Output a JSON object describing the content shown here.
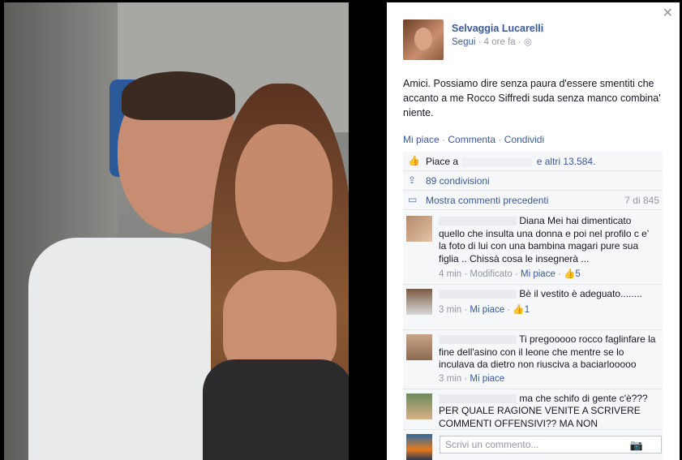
{
  "post": {
    "author": "Selvaggia Lucarelli",
    "follow": "Segui",
    "time": "4 ore fa",
    "privacy_icon": "globe-icon",
    "text": "Amici. Possiamo dire senza paura d'essere smentiti che accanto a me Rocco Siffredi suda senza manco combina' niente."
  },
  "actions": {
    "like": "Mi piace",
    "comment": "Commenta",
    "share": "Condividi"
  },
  "ufi": {
    "likes_prefix": "Piace a",
    "likes_suffix": "e altri 13.584.",
    "shares": "89 condivisioni",
    "more_comments": "Mostra commenti precedenti",
    "count": "7 di 845"
  },
  "comments": [
    {
      "text": "Diana Mei hai dimenticato quello che insulta una donna e poi nel profilo c e' la foto di lui con una bambina magari pure sua figlia .. Chissà cosa le insegnerà ...",
      "time": "4 min",
      "edited": "Modificato",
      "like": "Mi piace",
      "likes": "5"
    },
    {
      "text": "Bè il vestito è adeguato........",
      "time": "3 min",
      "like": "Mi piace",
      "likes": "1"
    },
    {
      "text": "Ti pregooooo rocco faglinfare la fine dell'asino con il leone che mentre se lo inculava da dietro non riusciva a baciarlooooo",
      "time": "3 min",
      "like": "Mi piace"
    },
    {
      "text": "ma che schifo di gente c'è??? PER QUALE RAGIONE VENITE A SCRIVERE COMMENTI OFFENSIVI?? MA NON",
      "time": "",
      "like": ""
    }
  ],
  "composer": {
    "placeholder": "Scrivi un commento..."
  },
  "icons": {
    "close": "close-icon",
    "camera": "camera-icon",
    "like": "thumbs-up-icon",
    "share": "share-icon",
    "comment": "comment-icon"
  }
}
